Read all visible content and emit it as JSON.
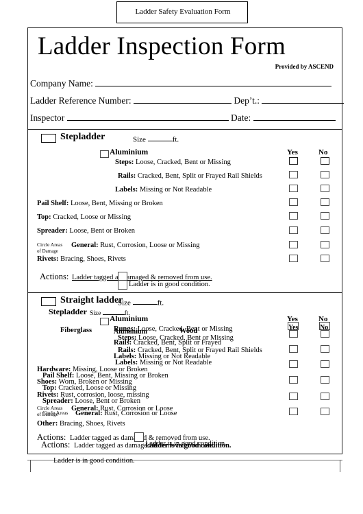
{
  "page": {
    "title_box_label": "Ladder Safety Evaluation Form",
    "form_title": "Ladder Inspection Form",
    "provided_by": "Provided by ASCEND"
  },
  "header_fields": {
    "company_label": "Company Name:",
    "company_value": "",
    "reference_label": "Ladder Reference Number:",
    "reference_value": "",
    "dept_label": "Dep’t.:",
    "dept_value": "",
    "inspector_label": "Inspector",
    "inspector_value": "",
    "date_label": "Date:",
    "date_value": ""
  },
  "columns": {
    "yes": "Yes",
    "no": "No"
  },
  "section1": {
    "type_label": "Stepladder",
    "size_label": "Size ______ft.",
    "size_prefix": "Size",
    "size_suffix": "ft.",
    "material_label": "Aluminium",
    "items": [
      {
        "label": "Steps:",
        "text": "Loose, Cracked, Bent or Missing"
      },
      {
        "label": "Rails:",
        "text": "Cracked, Bent, Split or Frayed Rail Shields"
      },
      {
        "label": "Labels:",
        "text": "Missing or Not Readable"
      },
      {
        "label": "Pail Shelf:",
        "text": "Loose, Bent, Missing or Broken"
      },
      {
        "label": "Top:",
        "text": "Cracked, Loose or Missing"
      },
      {
        "label": "Spreader:",
        "text": "Loose, Bent or Broken"
      },
      {
        "label": "General:",
        "text": "Rust, Corrosion, Loose or Missing"
      },
      {
        "label": "Rivets:",
        "text": "Bracing, Shoes, Rivets"
      }
    ],
    "circle_note_line1": "Circle Areas",
    "circle_note_line2": "of Damage",
    "actions_label": "Actions:",
    "actions_damaged": "Ladder tagged as damaged & removed from use.",
    "actions_good": "Ladder is in good condition."
  },
  "section2": {
    "type_label": "Straight ladder",
    "size_label": "Size ______ft.",
    "size_prefix": "Size",
    "size_suffix": "ft.",
    "material_fiberglass": "Fiberglass",
    "material_wood": "Wood",
    "items": [
      {
        "label": "Rungs:",
        "text": "Loose, Cracked, Bent or Missing"
      },
      {
        "label": "Rails:",
        "text": "Cracked, Bent, Split or Frayed"
      },
      {
        "label": "Labels:",
        "text": "Missing or Not Readable"
      },
      {
        "label": "Hardware:",
        "text": "Missing, Loose or Broken"
      },
      {
        "label": "Shoes:",
        "text": "Worn, Broken or Missing"
      },
      {
        "label": "Rivets:",
        "text": "Rust, corrosion, loose, missing"
      },
      {
        "label": "General:",
        "text": "Rust, Corrosion or Loose"
      },
      {
        "label": "Other:",
        "text": "Bracing, Shoes, Rivets"
      }
    ],
    "circle_note_line1": "Circle Areas",
    "circle_note_line2": "of Damage",
    "actions_label": "Actions:",
    "actions_damaged": "Ladder tagged as damaged & removed from use.",
    "actions_good": "Ladder is in good condition."
  },
  "section2_overlay": {
    "type_label": "Stepladder",
    "size_prefix": "Size",
    "size_suffix": "ft.",
    "material_label": "Aluminium",
    "items": [
      {
        "label": "Steps:",
        "text": "Loose, Cracked, Bent or Missing"
      },
      {
        "label": "Rails:",
        "text": "Cracked, Bent, Split or Frayed Rail Shields"
      },
      {
        "label": "Labels:",
        "text": "Missing or Not Readable"
      },
      {
        "label": "Pail Shelf:",
        "text": "Loose, Bent, Missing or Broken"
      },
      {
        "label": "Top:",
        "text": "Cracked, Loose or Missing"
      },
      {
        "label": "Spreader:",
        "text": "Loose, Bent or Broken"
      },
      {
        "label": "General:",
        "text": "Rust, Corrosion or Loose"
      }
    ],
    "circle_note_line1": "Circle Areas",
    "circle_note_line2": "of Damage",
    "actions_label": "Actions:",
    "actions_damaged": "Ladder tagged as damaged & removed from use.",
    "actions_good": "Ladder is in good condition."
  },
  "trailing": {
    "text": "Ladder is in good condition."
  }
}
